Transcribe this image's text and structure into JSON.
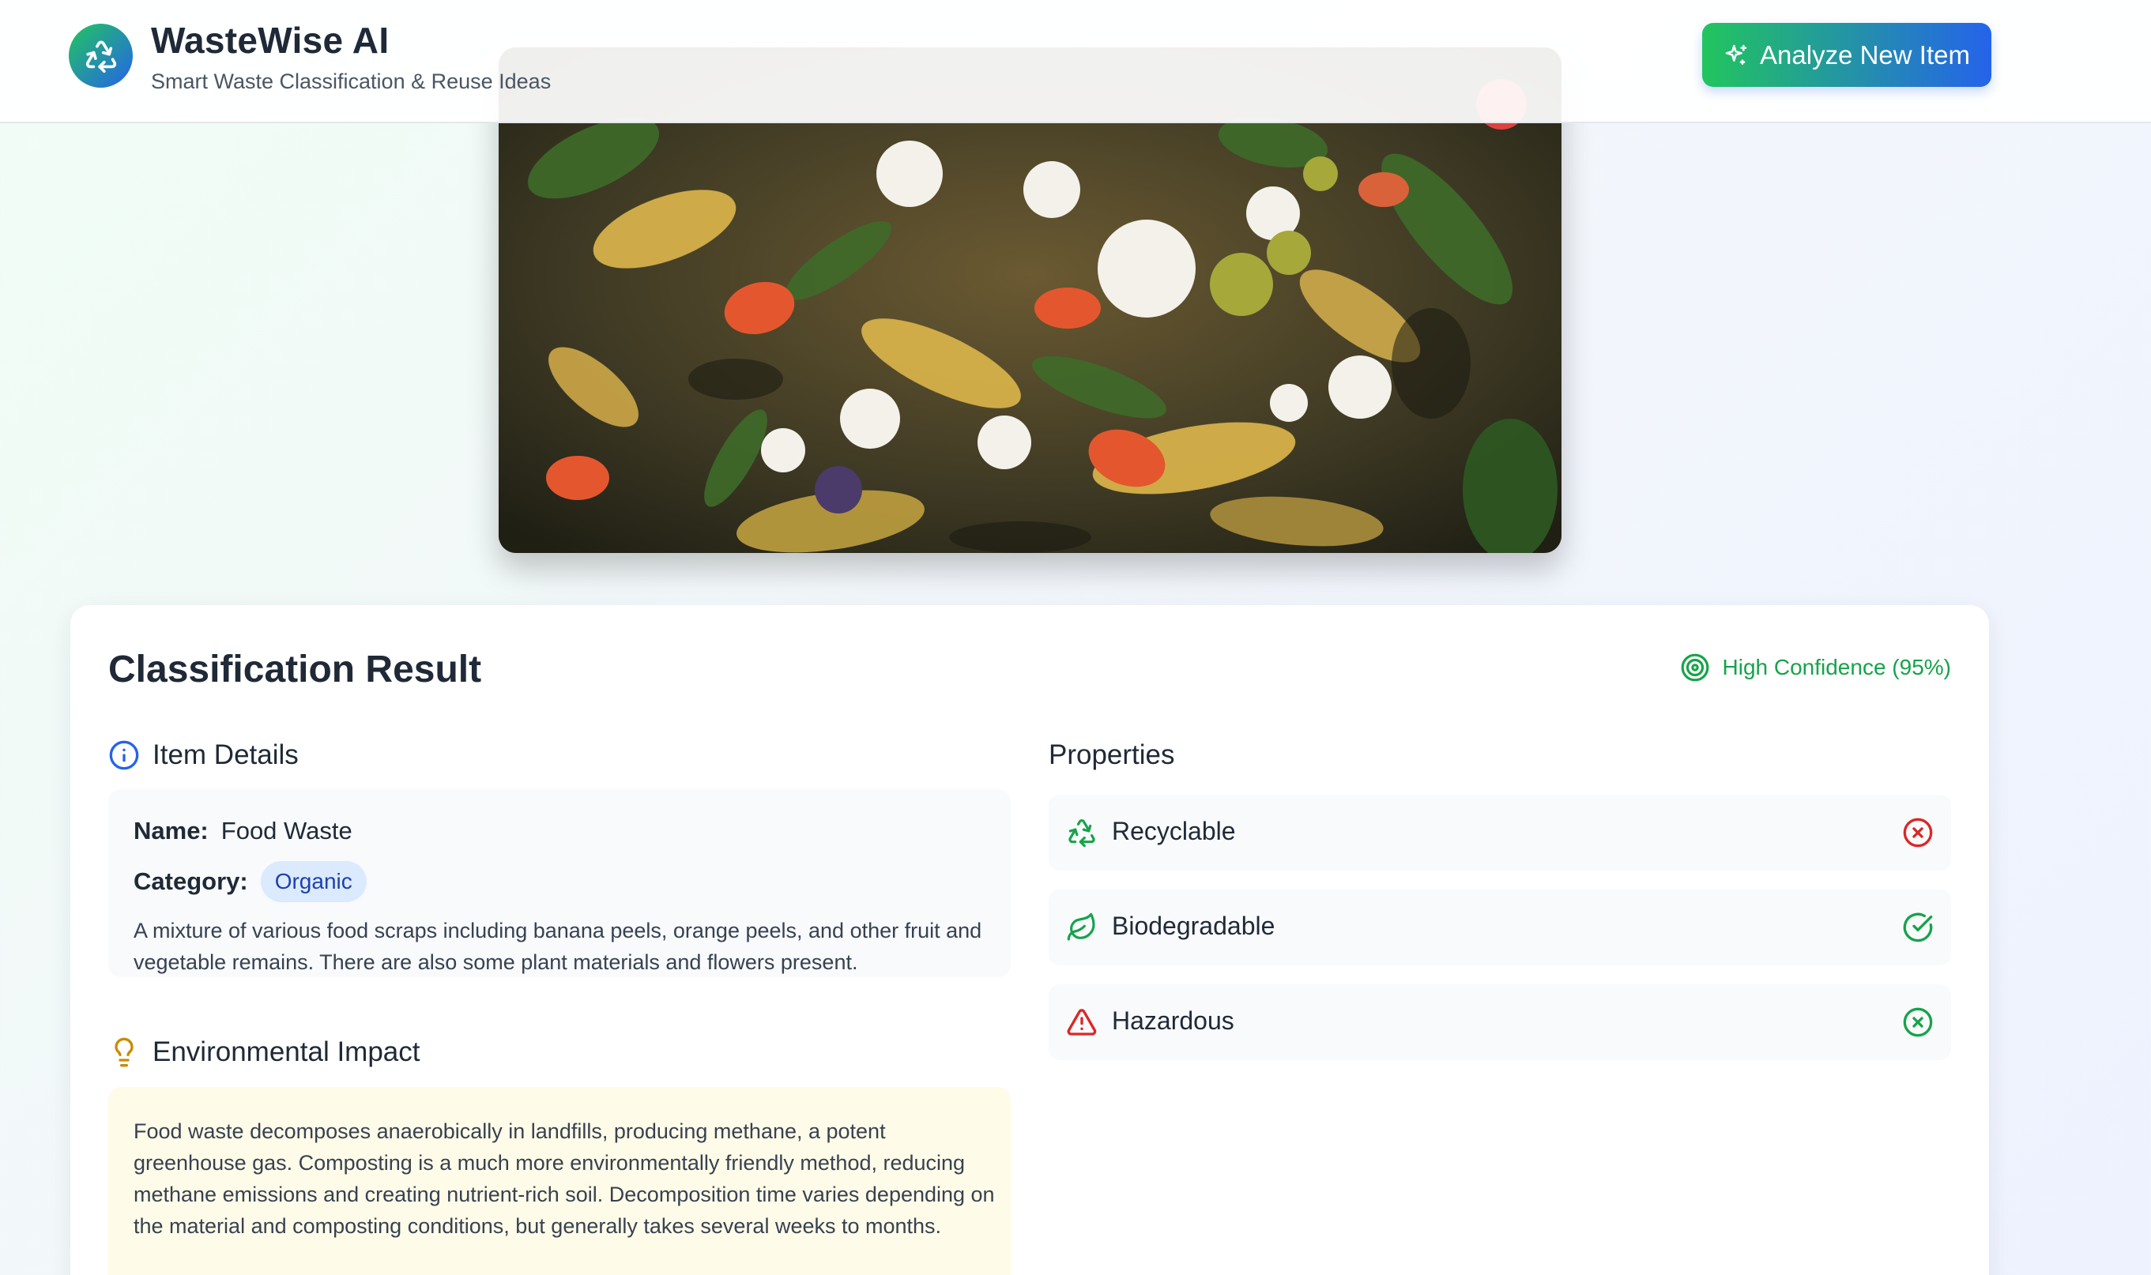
{
  "header": {
    "app_title": "WasteWise AI",
    "app_subtitle": "Smart Waste Classification & Reuse Ideas",
    "logo_icon": "recycle-icon",
    "analyze_button_label": "Analyze New Item",
    "analyze_button_icon": "sparkles-icon"
  },
  "image": {
    "subject": "food-waste-photo",
    "remove_button_color": "#ef4444"
  },
  "result": {
    "title": "Classification Result",
    "confidence_label": "High Confidence (95%)",
    "confidence_color": "#16a34a",
    "confidence_value": 95,
    "item_details": {
      "heading": "Item Details",
      "icon": "info-icon",
      "name_label": "Name:",
      "name_value": "Food Waste",
      "category_label": "Category:",
      "category_value": "Organic",
      "description": "A mixture of various food scraps including banana peels, orange peels, and other fruit and vegetable remains. There are also some plant materials and flowers present."
    },
    "environmental_impact": {
      "heading": "Environmental Impact",
      "icon": "lightbulb-icon",
      "text": "Food waste decomposes anaerobically in landfills, producing methane, a potent greenhouse gas. Composting is a much more environmentally friendly method, reducing methane emissions and creating nutrient-rich soil. Decomposition time varies depending on the material and composting conditions, but generally takes several weeks to months."
    },
    "properties": {
      "heading": "Properties",
      "items": [
        {
          "label": "Recyclable",
          "icon": "recycle-icon",
          "icon_color": "#16a34a",
          "status": "no",
          "status_icon": "x-circle-icon",
          "status_color": "#dc2626"
        },
        {
          "label": "Biodegradable",
          "icon": "leaf-icon",
          "icon_color": "#16a34a",
          "status": "yes",
          "status_icon": "check-circle-icon",
          "status_color": "#16a34a"
        },
        {
          "label": "Hazardous",
          "icon": "warning-triangle-icon",
          "icon_color": "#dc2626",
          "status": "no",
          "status_icon": "x-circle-icon",
          "status_color": "#16a34a"
        }
      ]
    }
  }
}
